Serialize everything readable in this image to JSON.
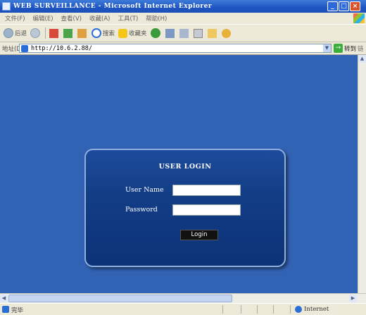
{
  "window": {
    "title": "WEB SURVEILLANCE - Microsoft Internet Explorer",
    "controls": {
      "minimize": "_",
      "maximize": "□",
      "close": "×"
    }
  },
  "menu": [
    "文件(F)",
    "编辑(E)",
    "查看(V)",
    "收藏(A)",
    "工具(T)",
    "帮助(H)"
  ],
  "toolbar": {
    "back_label": "后退",
    "search_label": "搜索",
    "favorites_label": "收藏夹"
  },
  "address": {
    "label": "地址(D)",
    "url": "http://10.6.2.88/",
    "go_label": "转到",
    "links_label": "链"
  },
  "login": {
    "title": "USER LOGIN",
    "username_label": "User Name",
    "password_label": "Password",
    "username_value": "",
    "password_value": "",
    "button_label": "Login"
  },
  "status": {
    "text": "完毕",
    "zone": "Internet"
  },
  "colors": {
    "page_background": "#3262b3",
    "panel_background": "#123d85",
    "titlebar": "#1f55c2"
  }
}
